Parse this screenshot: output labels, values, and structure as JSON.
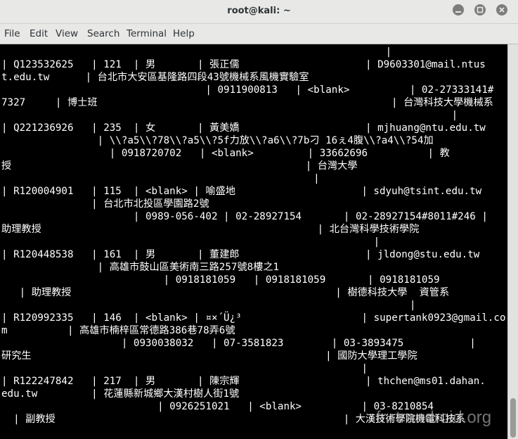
{
  "window": {
    "title": "root@kali: ~"
  },
  "menu": [
    "File",
    "Edit",
    "View",
    "Search",
    "Terminal",
    "Help"
  ],
  "terminal_lines": [
    "                                                                |",
    "| Q123532625   | 121  | 男       | 張正儒                     | D9603301@mail.ntus",
    "t.edu.tw      | 台北市大安區基隆路四段43號機械系風機實驗室",
    "                                  | 0911900813   | <blank>          | 02-27333141#",
    "7327     | 博士班                                                 | 台灣科技大學機械系",
    "                                                                           |",
    "| Q221236926   | 235  | 女       | 黃美嬌                     | mjhuang@ntu.edu.tw",
    "                | \\\\?a5\\\\?78\\\\?a5\\\\?5f力放\\\\?a6\\\\?7b刁 16ぇ4腹\\\\?a4\\\\?54加",
    "                  | 0918720702   | <blank>         | 33662696          | 教",
    "授                                                 | 台灣大學",
    "                                                    |",
    "| R120004901   | 115  | <blank> | 喻盛地                     | sdyuh@tsint.edu.tw",
    "               | 台北市北投區學園路2號",
    "                      | 0989-056-402 | 02-28927154       | 02-28927154#8011#246 |",
    "助理教授                                              | 北台灣科學技術學院",
    "                                                              |",
    "| R120448538   | 161  | 男       | 董建郎                     | jldong@stu.edu.tw",
    "                | 高雄市鼓山區美術南三路257號8樓之1",
    "                           | 0918181059   | 0918181059       | 0918181059",
    "   | 助理教授                                            | 樹德科技大學  資管系",
    "                                                                    |",
    "| R120992335   | 146  | <blank> | ¤×´Ü¿³                    | supertank0923@gmail.co",
    "m          | 高雄市楠梓區常德路386巷78弄6號",
    "                    | 0930038032   | 07-3581823        | 03-3893475           |",
    "研究生                                                 | 國防大學理工學院",
    "                                                            |",
    "| R122247842   | 217  | 男       | 陳宗輝                     | thchen@ms01.dahan.",
    "edu.tw         | 花蓮縣新城鄉大漢村樹人街1號",
    "                          | 0926251021   | <blank>          | 03-8210854",
    "  | 副教授                                                | 大漢技術學院機電科技系"
  ],
  "watermark": "fr.rtrandroid.org"
}
